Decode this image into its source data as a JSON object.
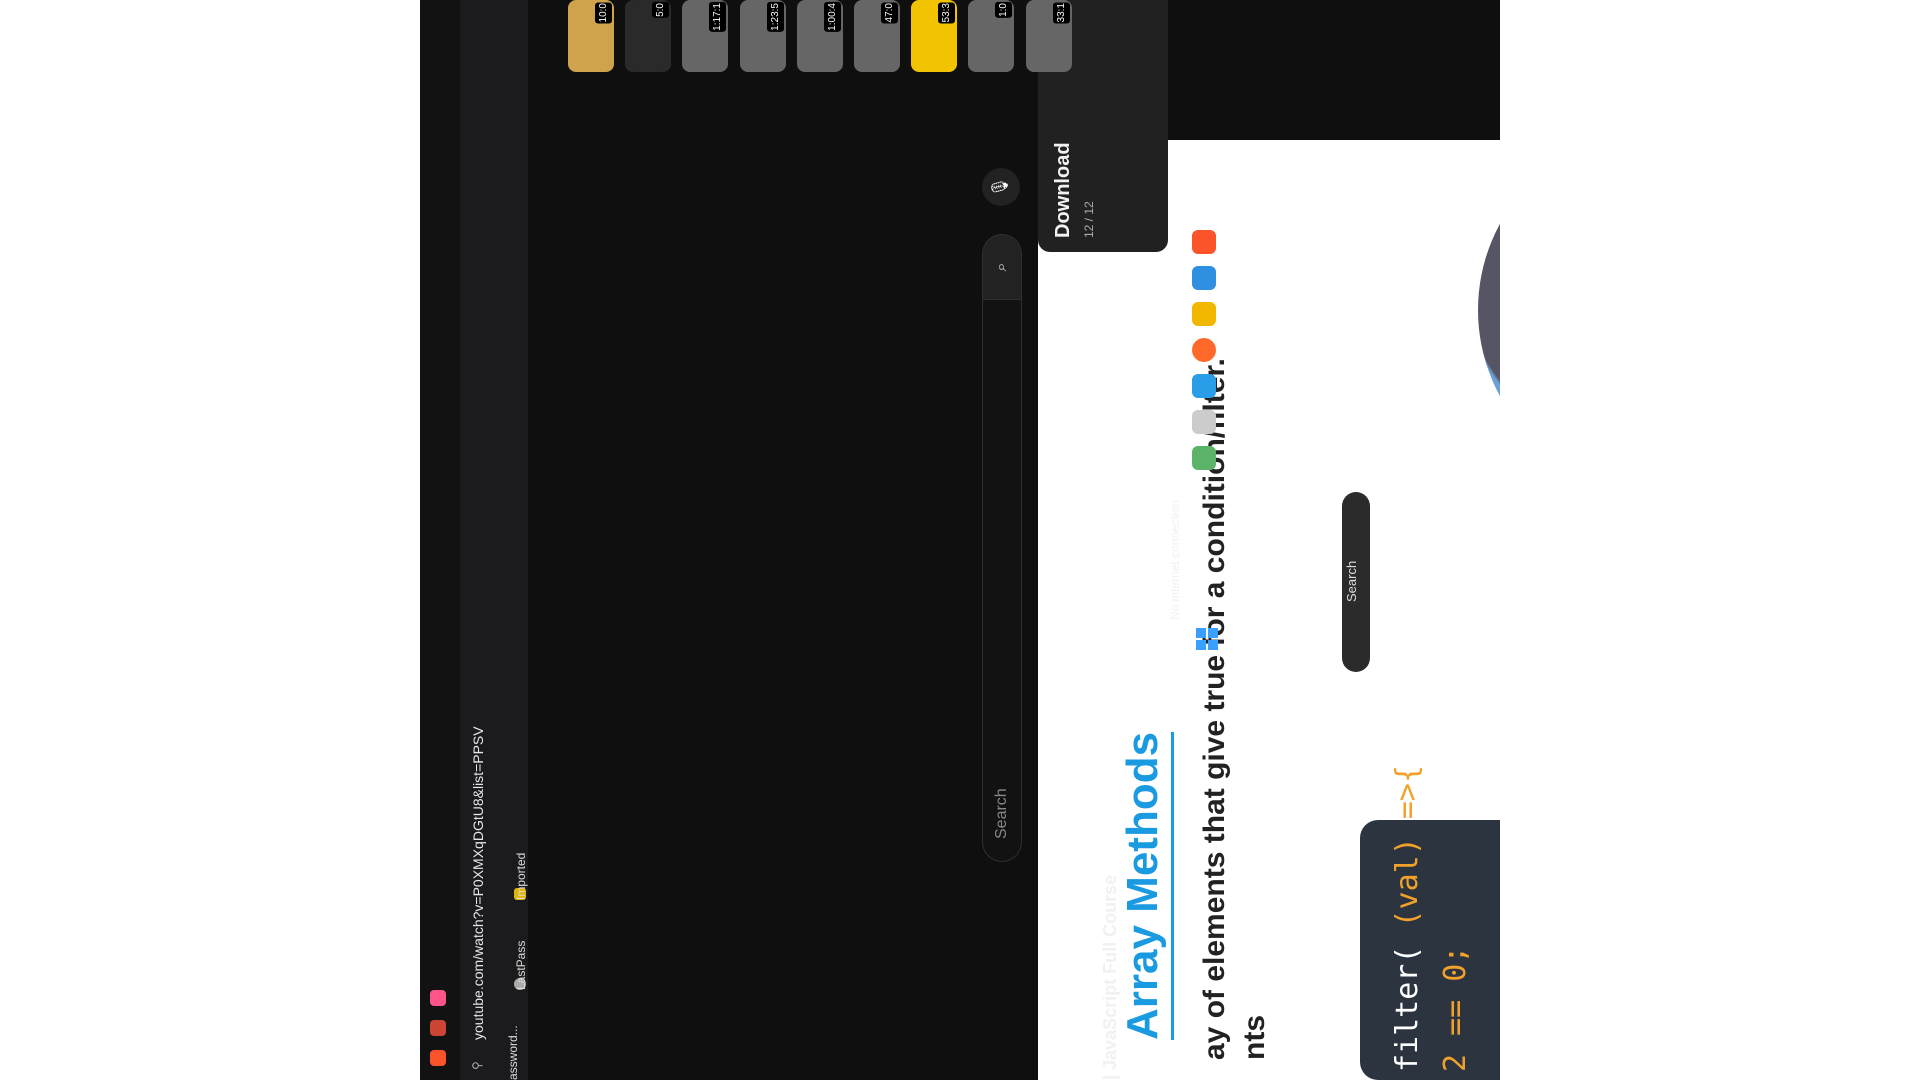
{
  "browser": {
    "address_url": "youtube.com/watch?v=P0XMXqDGtU8&list=PPSV",
    "bookmarks": [
      "assword...",
      "LastPass",
      "Imported from Micr..."
    ]
  },
  "youtube": {
    "search_placeholder": "Search"
  },
  "video": {
    "heading": "Array Methods",
    "line1": "ay of elements that give true for a condition/filter.",
    "line2": "nts",
    "code_line1_prefix": "filter(",
    "code_line1_arg": "(val) =>{",
    "code_line2": "2 == 0;"
  },
  "video_title_fragment": "| JavaScript Full Course",
  "playlist": {
    "title": "Download",
    "count": "12 / 12",
    "thumbs": [
      "10:0",
      "5:0",
      "1:17:1",
      "1:23:5",
      "1:00:4",
      "47:0",
      "53:3",
      "1:0",
      "33:1"
    ]
  },
  "status_text": "No internet connection",
  "taskbar": {
    "search_label": "Search"
  },
  "colors": {
    "accent_blue": "#1a9ae0",
    "code_bg": "#2c3440",
    "code_orange": "#f2a12b"
  }
}
